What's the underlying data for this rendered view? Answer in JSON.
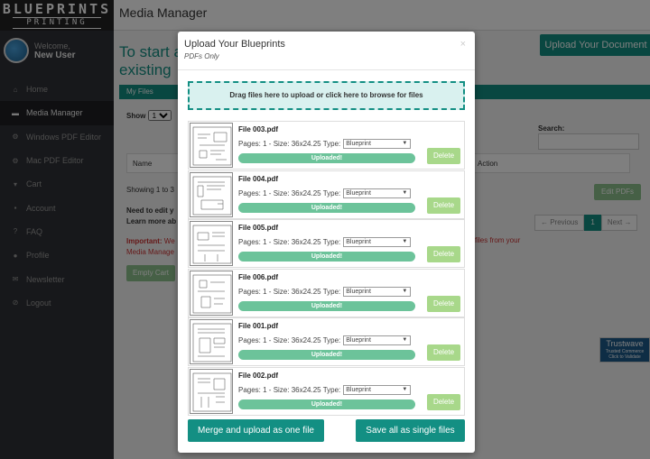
{
  "logo": {
    "line1": "BLUEPRINTS",
    "line2": "PRINTING"
  },
  "user": {
    "welcome": "Welcome,",
    "name": "New User"
  },
  "sidebar": {
    "items": [
      {
        "label": "Home",
        "icon": "home-icon",
        "glyph": "⌂"
      },
      {
        "label": "Media Manager",
        "icon": "folder-icon",
        "glyph": "▬"
      },
      {
        "label": "Windows PDF Editor",
        "icon": "gears-icon",
        "glyph": "⚙"
      },
      {
        "label": "Mac PDF Editor",
        "icon": "gears-icon",
        "glyph": "⚙"
      },
      {
        "label": "Cart",
        "icon": "cart-icon",
        "glyph": "▾"
      },
      {
        "label": "Account",
        "icon": "lock-icon",
        "glyph": "▪"
      },
      {
        "label": "FAQ",
        "icon": "question-icon",
        "glyph": "?"
      },
      {
        "label": "Profile",
        "icon": "user-icon",
        "glyph": "●"
      },
      {
        "label": "Newsletter",
        "icon": "envelope-icon",
        "glyph": "✉"
      },
      {
        "label": "Logout",
        "icon": "logout-icon",
        "glyph": "⊘"
      }
    ]
  },
  "main": {
    "title": "Media Manager",
    "big_line1": "To start a",
    "big_line2": "existing",
    "upload_button": "Upload Your Document",
    "tab": "My Files",
    "show_label": "Show",
    "show_value": "10",
    "search_label": "Search:",
    "col_name": "Name",
    "col_action": "Action",
    "showing": "Showing 1 to 3",
    "edit_pdfs": "Edit PDFs",
    "need_line1": "Need to edit y",
    "need_line2": "Learn more ab",
    "pager": {
      "prev": "← Previous",
      "page": "1",
      "next": "Next →"
    },
    "important_label": "Important:",
    "important_text": " We",
    "important_line2": "Media Manage",
    "important_tail": "files from your",
    "empty_cart": "Empty Cart",
    "trust_title": "Trustwave",
    "trust_sub1": "Trusted Commerce",
    "trust_sub2": "Click to Validate"
  },
  "modal": {
    "title": "Upload Your Blueprints",
    "subtitle": "PDFs Only",
    "close": "×",
    "dropzone": "Drag files here to upload or click here to browse for files",
    "files": [
      {
        "name": "File 003.pdf",
        "meta": "Pages: 1 - Size: 36x24.25 Type:",
        "type": "Blueprint",
        "status": "Uploaded!",
        "delete": "Delete"
      },
      {
        "name": "File 004.pdf",
        "meta": "Pages: 1 - Size: 36x24.25 Type:",
        "type": "Blueprint",
        "status": "Uploaded!",
        "delete": "Delete"
      },
      {
        "name": "File 005.pdf",
        "meta": "Pages: 1 - Size: 36x24.25 Type:",
        "type": "Blueprint",
        "status": "Uploaded!",
        "delete": "Delete"
      },
      {
        "name": "File 006.pdf",
        "meta": "Pages: 1 - Size: 36x24.25 Type:",
        "type": "Blueprint",
        "status": "Uploaded!",
        "delete": "Delete"
      },
      {
        "name": "File 001.pdf",
        "meta": "Pages: 1 - Size: 36x24.25 Type:",
        "type": "Blueprint",
        "status": "Uploaded!",
        "delete": "Delete"
      },
      {
        "name": "File 002.pdf",
        "meta": "Pages: 1 - Size: 36x24.25 Type:",
        "type": "Blueprint",
        "status": "Uploaded!",
        "delete": "Delete"
      }
    ],
    "merge_button": "Merge and upload as one file",
    "save_button": "Save all as single files"
  },
  "colors": {
    "accent": "#138f83",
    "progress": "#6cc39a",
    "delete": "#a8d88a",
    "sidebar": "#2f3136"
  }
}
